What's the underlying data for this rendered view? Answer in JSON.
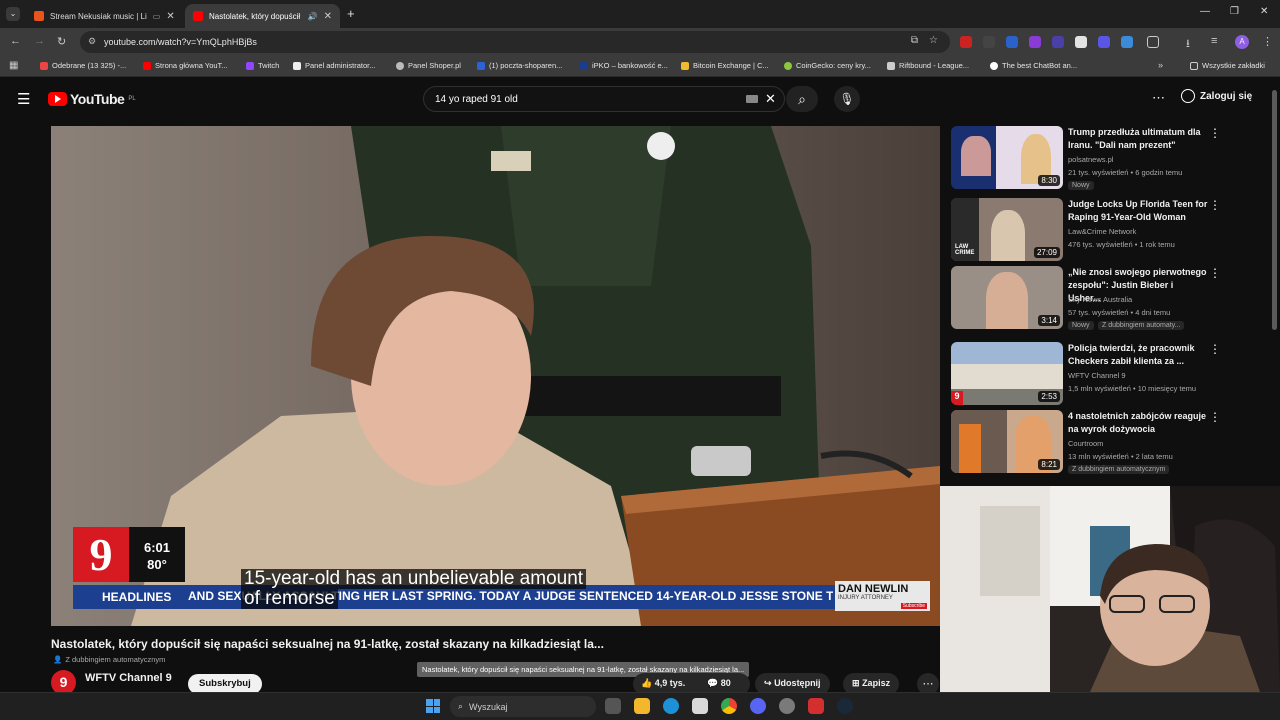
{
  "browser": {
    "tabs": [
      {
        "title": "Stream Nekusiak music | Li",
        "active": false
      },
      {
        "title": "Nastolatek, który dopuścił s",
        "active": true
      }
    ],
    "new_tab": "+",
    "url": "youtube.com/watch?v=YmQLphHBjBs",
    "bookmarks": [
      "Odebrane (13 325) -...",
      "Strona główna YouT...",
      "Twitch",
      "Panel administrator...",
      "Panel Shoper.pl",
      "(1) poczta-shoparen...",
      "iPKO – bankowość e...",
      "Bitcoin Exchange | C...",
      "CoinGecko: ceny kry...",
      "Riftbound - League...",
      "The best ChatBot an..."
    ],
    "all_bookmarks": "Wszystkie zakładki"
  },
  "youtube": {
    "logo_text": "YouTube",
    "logo_region": "PL",
    "search_value": "14 yo raped 91 old",
    "sign_in": "Zaloguj się"
  },
  "video": {
    "overlay": {
      "channel_number": "9",
      "time": "6:01",
      "temp": "80°",
      "headlines": "HEADLINES",
      "ticker": "AND SEXUALLY ASSAULTING HER LAST SPRING. TODAY A JUDGE SENTENCED 14-YEAR-OLD JESSE STONE TO 25",
      "ad_name": "DAN NEWLIN",
      "ad_sub": "INJURY ATTORNEY",
      "ad_subscribe": "Subscribe",
      "caption_line1": "15-year-old has an unbelievable amount",
      "caption_line2": "of remorse"
    },
    "title": "Nastolatek, który dopuścił się napaści seksualnej na 91-latkę, został skazany na kilkadziesiąt la...",
    "dubbing": "Z dubbingiem automatycznym",
    "tooltip": "Nastolatek, który dopuścił się napaści seksualnej na 91-latkę, został skazany na kilkadziesiąt la...",
    "channel": "WFTV Channel 9",
    "subscribe": "Subskrybuj",
    "likes": "4,9 tys.",
    "comments": "80",
    "share": "Udostępnij",
    "save": "Zapisz"
  },
  "recommendations": [
    {
      "title": "Trump przedłuża ultimatum dla Iranu. \"Dali nam prezent\"",
      "channel": "polsatnews.pl",
      "meta": "21 tys. wyświetleń • 6 godzin temu",
      "badge": "Nowy",
      "dub": "",
      "duration": "8:30"
    },
    {
      "title": "Judge Locks Up Florida Teen for Raping 91-Year-Old Woman",
      "channel": "Law&Crime Network",
      "meta": "476 tys. wyświetleń • 1 rok temu",
      "badge": "",
      "dub": "",
      "duration": "27:09"
    },
    {
      "title": "„Nie znosi swojego pierwotnego zespołu\": Justin Bieber i Usher...",
      "channel": "Sky News Australia",
      "meta": "57 tys. wyświetleń • 4 dni temu",
      "badge": "Nowy",
      "dub": "Z dubbingiem automaty...",
      "duration": "3:14"
    },
    {
      "title": "Policja twierdzi, że pracownik Checkers zabił klienta za ...",
      "channel": "WFTV Channel 9",
      "meta": "1,5 mln wyświetleń • 10 miesięcy temu",
      "badge": "",
      "dub": "",
      "duration": "2:53"
    },
    {
      "title": "4 nastoletnich zabójców reaguje na wyrok dożywocia",
      "channel": "Courtroom",
      "meta": "13 mln wyświetleń • 2 lata temu",
      "badge": "",
      "dub": "Z dubbingiem automatycznym",
      "duration": "8:21"
    }
  ],
  "taskbar": {
    "search_placeholder": "Wyszukaj"
  },
  "colors": {
    "yt_red": "#ff0000",
    "channel9_red": "#d71921",
    "ticker_blue": "#1d3f8f"
  }
}
